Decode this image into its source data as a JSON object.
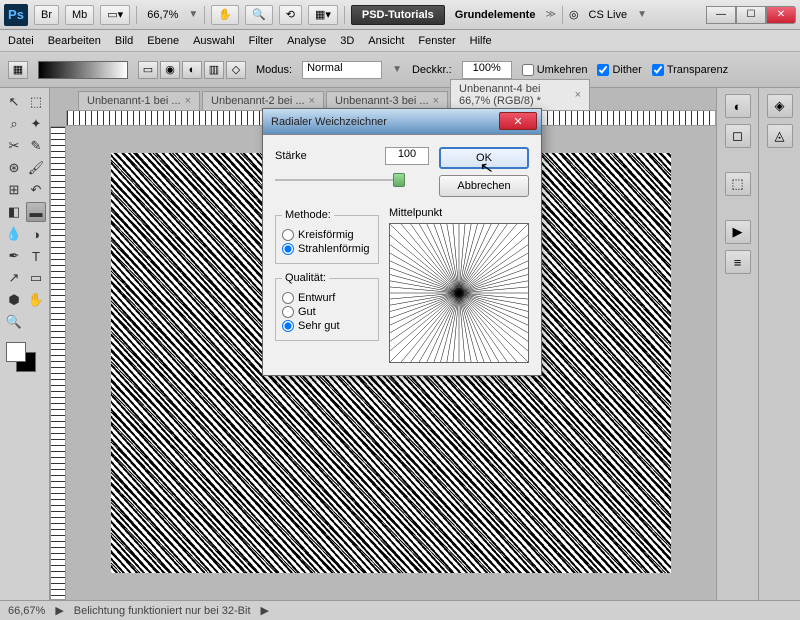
{
  "titlebar": {
    "logo": "Ps",
    "br": "Br",
    "mb": "Mb",
    "zoom": "66,7%",
    "brand": "PSD-Tutorials",
    "project": "Grundelemente",
    "cslive": "CS Live"
  },
  "menu": [
    "Datei",
    "Bearbeiten",
    "Bild",
    "Ebene",
    "Auswahl",
    "Filter",
    "Analyse",
    "3D",
    "Ansicht",
    "Fenster",
    "Hilfe"
  ],
  "opts": {
    "modus_label": "Modus:",
    "modus_value": "Normal",
    "deck_label": "Deckkr.:",
    "deck_value": "100%",
    "umkehren": "Umkehren",
    "dither": "Dither",
    "transparenz": "Transparenz"
  },
  "doctabs": [
    {
      "label": "Unbenannt-1 bei ..."
    },
    {
      "label": "Unbenannt-2 bei ..."
    },
    {
      "label": "Unbenannt-3 bei ..."
    },
    {
      "label": "Unbenannt-4 bei 66,7% (RGB/8) *",
      "active": true
    }
  ],
  "dialog": {
    "title": "Radialer Weichzeichner",
    "staerke_label": "Stärke",
    "staerke_value": "100",
    "ok": "OK",
    "cancel": "Abbrechen",
    "methode_label": "Methode:",
    "methode": [
      {
        "k": "Kreisförmig",
        "sel": false
      },
      {
        "k": "Strahlenförmig",
        "sel": true
      }
    ],
    "qualitaet_label": "Qualität:",
    "qualitaet": [
      {
        "k": "Entwurf",
        "sel": false
      },
      {
        "k": "Gut",
        "sel": false
      },
      {
        "k": "Sehr gut",
        "sel": true
      }
    ],
    "mittelpunkt": "Mittelpunkt"
  },
  "status": {
    "zoom": "66,67%",
    "msg": "Belichtung funktioniert nur bei 32-Bit"
  }
}
